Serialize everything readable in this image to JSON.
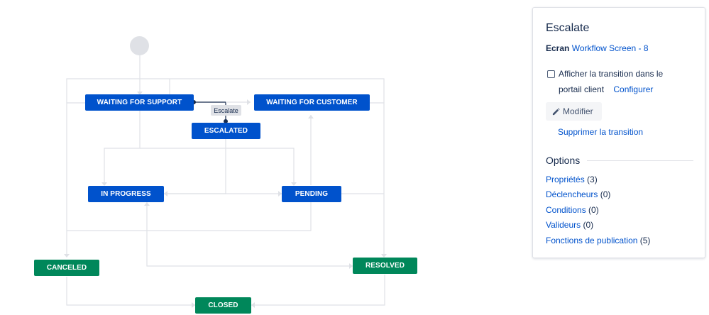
{
  "diagram": {
    "statuses": {
      "waiting_for_support": "WAITING FOR SUPPORT",
      "waiting_for_customer": "WAITING FOR CUSTOMER",
      "escalated": "ESCALATED",
      "in_progress": "IN PROGRESS",
      "pending": "PENDING",
      "canceled": "CANCELED",
      "resolved": "RESOLVED",
      "closed": "CLOSED"
    },
    "selected_transition_label": "Escalate",
    "colors": {
      "status_blue": "#0052cc",
      "status_green": "#00875a",
      "connector": "#dfe1e6",
      "selected_connector": "#172b4d",
      "start_node": "#dfe1e6"
    }
  },
  "panel": {
    "title": "Escalate",
    "screen_label": "Ecran",
    "screen_value": "Workflow Screen - 8",
    "checkbox_line1": "Afficher la transition dans le",
    "checkbox_line2": "portail client",
    "configure_link": "Configurer",
    "checkbox_checked": false,
    "edit_button": "Modifier",
    "edit_icon": "pencil-icon",
    "delete_link": "Supprimer la transition",
    "options_heading": "Options",
    "options": [
      {
        "label": "Propriétés",
        "count": "(3)"
      },
      {
        "label": "Déclencheurs",
        "count": "(0)"
      },
      {
        "label": "Conditions",
        "count": "(0)"
      },
      {
        "label": "Valideurs",
        "count": "(0)"
      },
      {
        "label": "Fonctions de publication",
        "count": "(5)"
      }
    ],
    "link_color": "#0052cc"
  }
}
